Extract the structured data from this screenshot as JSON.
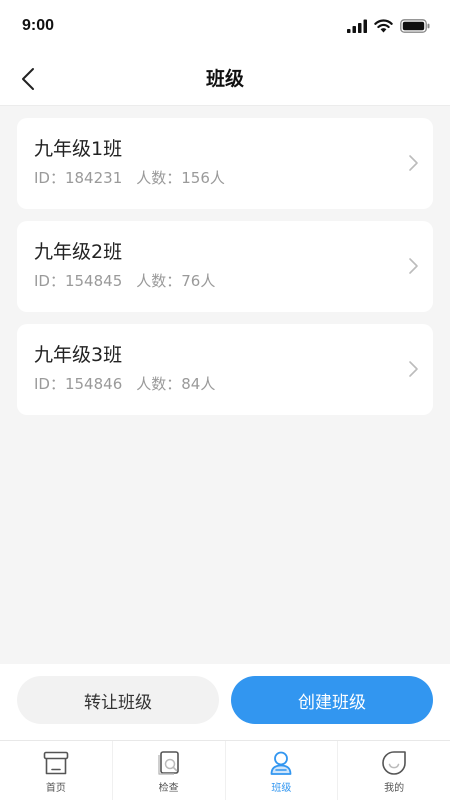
{
  "status_bar": {
    "time": "9:00"
  },
  "nav": {
    "title": "班级"
  },
  "classes": [
    {
      "name": "九年级1班",
      "id_label": "ID：184231",
      "count_label": "人数：156人"
    },
    {
      "name": "九年级2班",
      "id_label": "ID：154845",
      "count_label": "人数：76人"
    },
    {
      "name": "九年级3班",
      "id_label": "ID：154846",
      "count_label": "人数：84人"
    }
  ],
  "actions": {
    "transfer_label": "转让班级",
    "create_label": "创建班级"
  },
  "tabs": [
    {
      "label": "首页",
      "icon": "home-icon",
      "active": false
    },
    {
      "label": "检查",
      "icon": "inspect-icon",
      "active": false
    },
    {
      "label": "班级",
      "icon": "class-icon",
      "active": true
    },
    {
      "label": "我的",
      "icon": "profile-icon",
      "active": false
    }
  ],
  "colors": {
    "accent": "#3296f0",
    "background": "#f5f5f5",
    "secondary_text": "#9a9a9a"
  }
}
